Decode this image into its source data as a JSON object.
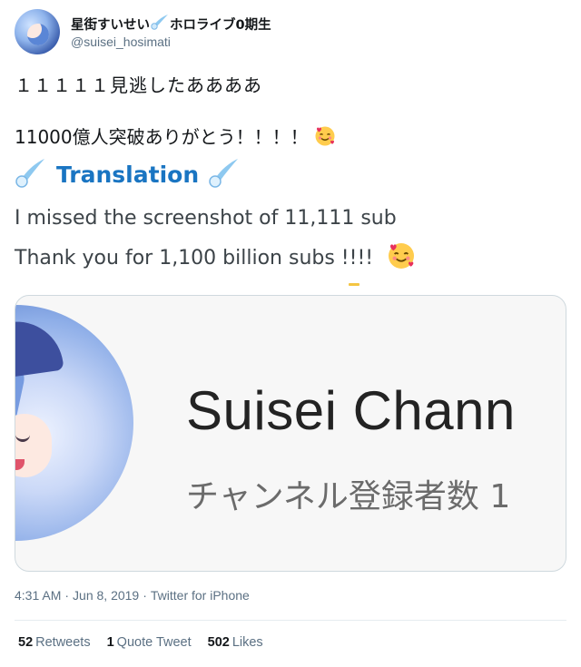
{
  "user": {
    "display_name": "星街すいせい",
    "display_name_suffix": "ホロライブ0期生",
    "handle": "@suisei_hosimati"
  },
  "tweet": {
    "line1": "１１１１１見逃したああああ",
    "line2": "11000億人突破ありがとう！！！！",
    "translation_label": "Translation",
    "translation_line1": "I missed the screenshot of 11,111 sub",
    "translation_line2": "Thank you for 1,100 billion subs !!!!"
  },
  "media": {
    "channel_title": "Suisei Chann",
    "channel_subtitle": "チャンネル登録者数 1"
  },
  "meta": {
    "time": "4:31 AM",
    "date": "Jun 8, 2019",
    "source": "Twitter for iPhone"
  },
  "stats": {
    "retweets_count": "52",
    "retweets_label": "Retweets",
    "quotes_count": "1",
    "quotes_label": "Quote Tweet",
    "likes_count": "502",
    "likes_label": "Likes"
  },
  "icons": {
    "meteor": "comet-icon",
    "emoji": "smiling-face-with-hearts-icon"
  },
  "colors": {
    "translation_accent": "#1a75c2",
    "meteor_blue": "#8ec9f0",
    "secondary_text": "#5b7083"
  }
}
